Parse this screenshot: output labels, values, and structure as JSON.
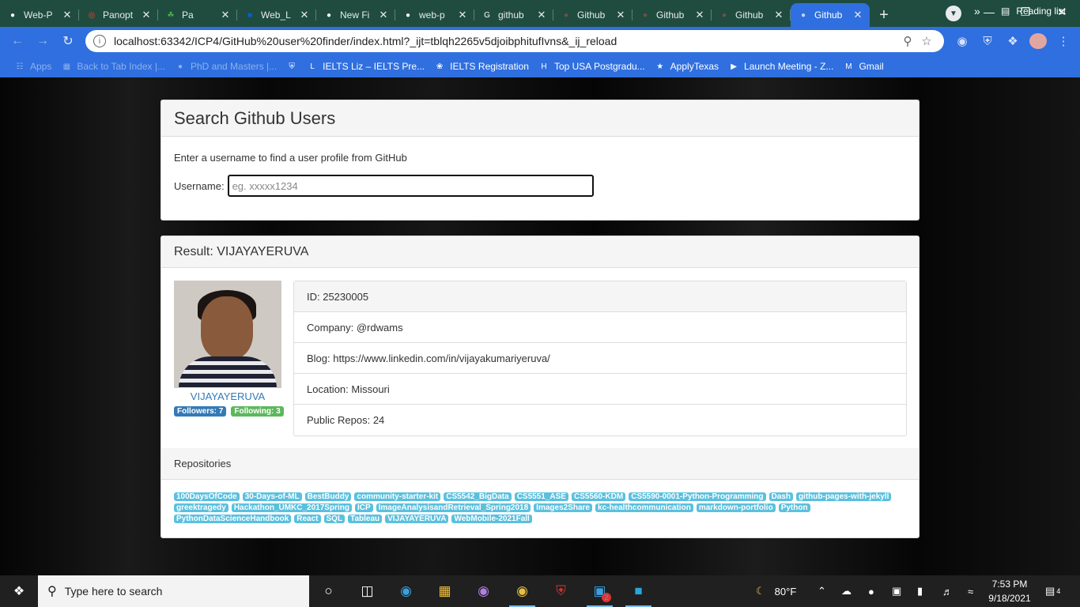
{
  "browser": {
    "tabs": [
      {
        "title": "Web-P",
        "icon": "github-icon",
        "icon_color": "#ffffff"
      },
      {
        "title": "Panopt",
        "icon": "panopto-icon",
        "icon_color": "#e8453c"
      },
      {
        "title": "Pa",
        "icon": "leaf-icon",
        "icon_color": "#4caf50"
      },
      {
        "title": "Web_L",
        "icon": "box-icon",
        "icon_color": "#0061d5"
      },
      {
        "title": "New Fi",
        "icon": "github-icon",
        "icon_color": "#ffffff"
      },
      {
        "title": "web-p",
        "icon": "github-icon",
        "icon_color": "#ffffff"
      },
      {
        "title": "github",
        "icon": "google-icon",
        "icon_color": "#ffffff"
      },
      {
        "title": "Github",
        "icon": "globe-icon",
        "icon_color": "#7a4e3e"
      },
      {
        "title": "Github",
        "icon": "globe-icon",
        "icon_color": "#7a4e3e"
      },
      {
        "title": "Github",
        "icon": "globe-icon",
        "icon_color": "#7a4e3e"
      },
      {
        "title": "Github",
        "icon": "globe-icon",
        "icon_color": "#c6d4f5",
        "active": true
      }
    ],
    "url": "localhost:63342/ICP4/GitHub%20user%20finder/index.html?_ijt=tblqh2265v5djoibphitufIvns&_ij_reload",
    "bookmarks": [
      {
        "label": "Apps",
        "icon": "apps-icon",
        "faded": true
      },
      {
        "label": "Back to Tab Index |...",
        "icon": "colorful-grid-icon",
        "faded": true
      },
      {
        "label": "PhD and Masters |...",
        "icon": "globe-icon",
        "faded": true
      },
      {
        "label": "",
        "icon": "shield-crest-icon",
        "faded": false
      },
      {
        "label": "IELTS Liz – IELTS Pre...",
        "icon": "liz-icon",
        "faded": false
      },
      {
        "label": "IELTS Registration",
        "icon": "flower-icon",
        "faded": false
      },
      {
        "label": "Top USA Postgradu...",
        "icon": "h-icon",
        "faded": false
      },
      {
        "label": "ApplyTexas",
        "icon": "star-icon",
        "faded": false
      },
      {
        "label": "Launch Meeting - Z...",
        "icon": "zoom-icon",
        "faded": false
      },
      {
        "label": "Gmail",
        "icon": "gmail-icon",
        "faded": false
      }
    ],
    "reading_list": "Reading list"
  },
  "search": {
    "title": "Search Github Users",
    "description": "Enter a username to find a user profile from GitHub",
    "label": "Username:",
    "placeholder": "eg. xxxxx1234"
  },
  "result": {
    "title": "Result: VIJAYAYERUVA",
    "login": "VIJAYAYERUVA",
    "followers": "Followers: 7",
    "following": "Following: 3",
    "info": [
      "ID: 25230005",
      "Company: @rdwams",
      "Blog: https://www.linkedin.com/in/vijayakumariyeruva/",
      "Location: Missouri",
      "Public Repos: 24"
    ],
    "repos_title": "Repositories",
    "repos": [
      "100DaysOfCode",
      "30-Days-of-ML",
      "BestBuddy",
      "community-starter-kit",
      "CS5542_BigData",
      "CS5551_ASE",
      "CS5560-KDM",
      "CS5590-0001-Python-Programming",
      "Dash",
      "github-pages-with-jekyll",
      "greektragedy",
      "Hackathon_UMKC_2017Spring",
      "ICP",
      "ImageAnalysisandRetrieval_Spring2018",
      "Images2Share",
      "kc-healthcommunication",
      "markdown-portfolio",
      "Python",
      "PythonDataScienceHandbook",
      "React",
      "SQL",
      "Tableau",
      "VIJAYAYERUVA",
      "WebMobile-2021Fall"
    ]
  },
  "taskbar": {
    "search_placeholder": "Type here to search",
    "weather": "80°F",
    "time": "7:53 PM",
    "date": "9/18/2021",
    "notifications": "4",
    "teams_badge": "2"
  },
  "colors": {
    "tab_strip": "#1f4c3f",
    "toolbar": "#2f6fdf",
    "link": "#337ab7",
    "repo_badge": "#5bc0de"
  }
}
